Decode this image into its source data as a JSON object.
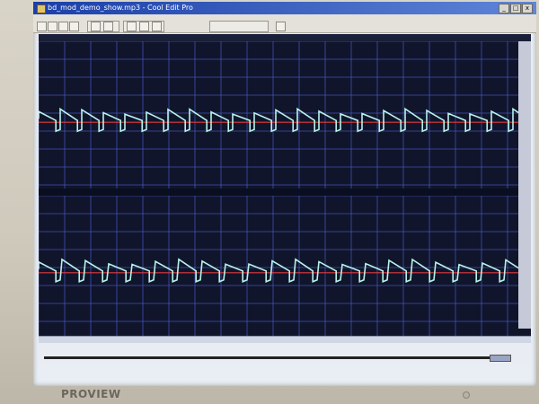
{
  "window": {
    "title": "bd_mod_demo_show.mp3 - Cool Edit Pro",
    "buttons": {
      "minimize": "_",
      "maximize": "□",
      "close": "x"
    }
  },
  "toolbar": {
    "icons": [
      "new-icon",
      "open-icon",
      "save-icon",
      "print-icon",
      "undo-icon",
      "cut-icon",
      "copy-icon",
      "paste-icon",
      "mix-icon",
      "zoom-icon"
    ]
  },
  "waveform": {
    "colors": {
      "background": "#10152c",
      "grid": "#4d5fd0",
      "wave": "#b8f3e8",
      "centerline": "#e43a3a"
    },
    "channels": [
      {
        "name": "left-channel"
      },
      {
        "name": "right-channel"
      }
    ]
  },
  "monitor": {
    "brand": "PROVIEW"
  }
}
